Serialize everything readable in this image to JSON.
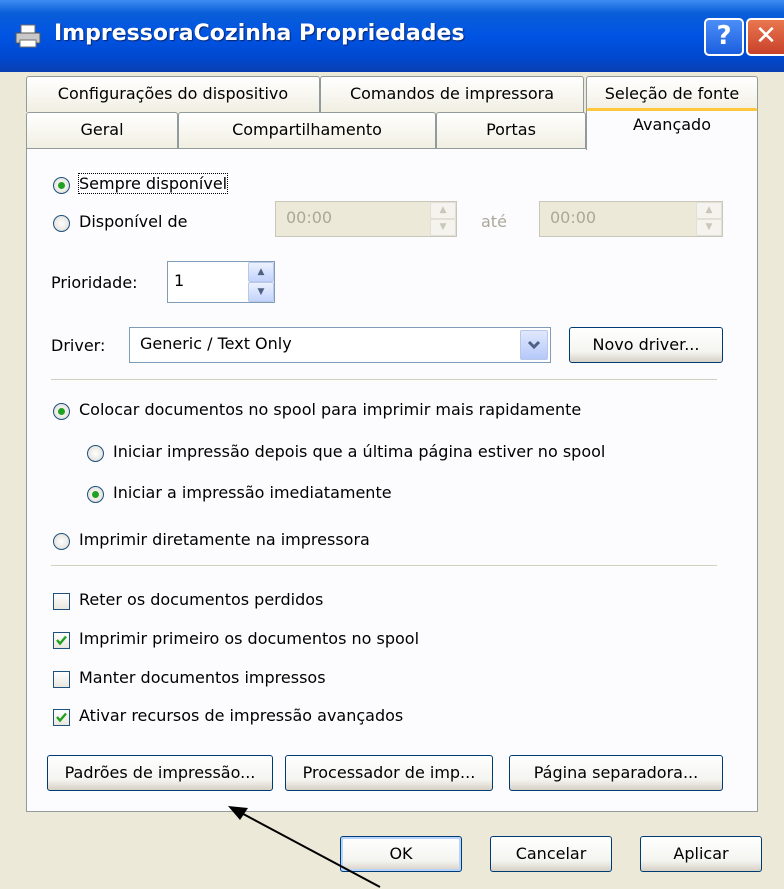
{
  "window": {
    "title": "ImpressoraCozinha Propriedades",
    "help_glyph": "?",
    "close_glyph": "✕"
  },
  "tabs_top": [
    "Configurações do dispositivo",
    "Comandos de impressora",
    "Seleção de fonte"
  ],
  "tabs_bottom": [
    "Geral",
    "Compartilhamento",
    "Portas",
    "Avançado"
  ],
  "availability": {
    "always_label": "Sempre disponível",
    "from_label": "Disponível de",
    "from_time": "00:00",
    "to_label": "até",
    "to_time": "00:00",
    "selected": "always"
  },
  "priority": {
    "label": "Prioridade:",
    "value": "1"
  },
  "driver": {
    "label": "Driver:",
    "selected": "Generic / Text Only",
    "new_driver_button": "Novo driver..."
  },
  "spool": {
    "spool_label": "Colocar documentos no spool para imprimir mais rapidamente",
    "after_last_page_label": "Iniciar impressão depois que a última página estiver no spool",
    "immediately_label": "Iniciar a impressão imediatamente",
    "direct_label": "Imprimir diretamente na impressora"
  },
  "options": [
    {
      "label": "Reter os documentos perdidos",
      "checked": false
    },
    {
      "label": "Imprimir primeiro os documentos no spool",
      "checked": true
    },
    {
      "label": "Manter documentos impressos",
      "checked": false
    },
    {
      "label": "Ativar recursos de impressão avançados",
      "checked": true
    }
  ],
  "panel_buttons": {
    "defaults": "Padrões de impressão...",
    "processor": "Processador de imp...",
    "separator_page": "Página separadora..."
  },
  "dialog_buttons": {
    "ok": "OK",
    "cancel": "Cancelar",
    "apply": "Aplicar"
  },
  "colors": {
    "titlebar": "#0054e3",
    "dialog_bg": "#ece9d8",
    "active_tab_accent": "#ffc83c",
    "radio_dot": "#21a121",
    "check_mark": "#21a121"
  }
}
